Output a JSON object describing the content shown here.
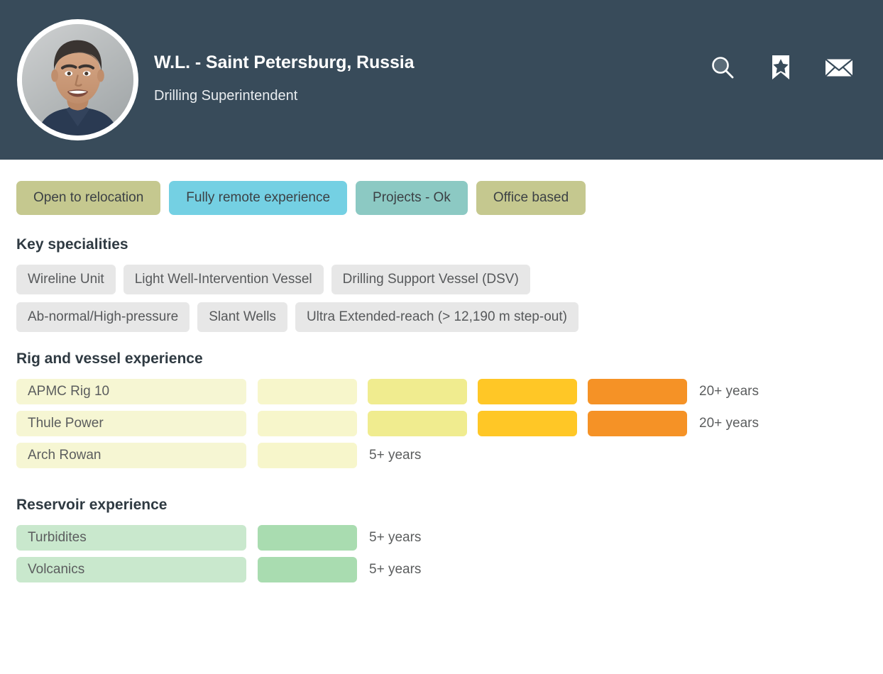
{
  "header": {
    "name": "W.L. - Saint Petersburg, Russia",
    "role": "Drilling Superintendent",
    "avatar_alt": "candidate-photo",
    "actions": [
      {
        "name": "search-icon",
        "label": "Search"
      },
      {
        "name": "bookmark-star-icon",
        "label": "Shortlist"
      },
      {
        "name": "envelope-icon",
        "label": "Message"
      }
    ]
  },
  "status_tags": [
    {
      "label": "Open to relocation",
      "color": "#c5c88f"
    },
    {
      "label": "Fully remote experience",
      "color": "#74d0e3"
    },
    {
      "label": "Projects - Ok",
      "color": "#8cc9c3"
    },
    {
      "label": "Office based",
      "color": "#c5c88f"
    }
  ],
  "specialities": {
    "title": "Key specialities",
    "rows": [
      [
        "Wireline Unit",
        "Light Well-Intervention Vessel",
        "Drilling Support Vessel (DSV)"
      ],
      [
        "Ab-normal/High-pressure",
        "Slant Wells",
        "Ultra Extended-reach (> 12,190 m step-out)"
      ]
    ]
  },
  "rig_experience": {
    "title": "Rig and vessel experience",
    "label_bg": "#f6f6d3",
    "segment_colors": [
      "#f7f6cb",
      "#f0ec8f",
      "#ffc726",
      "#f59226"
    ],
    "rows": [
      {
        "label": "APMC Rig 10",
        "segments": 4,
        "years": "20+ years"
      },
      {
        "label": "Thule Power",
        "segments": 4,
        "years": "20+ years"
      },
      {
        "label": "Arch Rowan",
        "segments": 1,
        "years": "5+ years"
      }
    ]
  },
  "reservoir_experience": {
    "title": "Reservoir experience",
    "label_bg": "#c9e8cd",
    "segment_colors": [
      "#a9dcb0",
      "#a9dcb0",
      "#a9dcb0",
      "#a9dcb0"
    ],
    "rows": [
      {
        "label": "Turbidites",
        "segments": 1,
        "years": "5+ years"
      },
      {
        "label": "Volcanics",
        "segments": 1,
        "years": "5+ years"
      }
    ]
  },
  "theme": {
    "header_bg": "#384b5a",
    "page_bg": "#ffffff",
    "chip_bg": "#e7e7e7",
    "title_color": "#2f3a42"
  }
}
